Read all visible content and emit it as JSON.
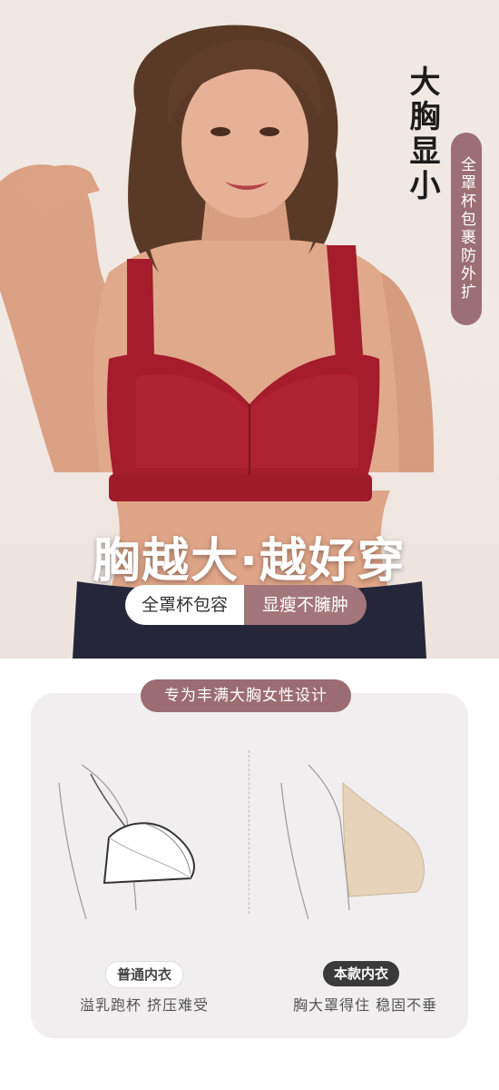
{
  "hero": {
    "headline": "大胸显小",
    "vertical_pill": "全罩杯包裹防外扩",
    "slogan": "胸越大·越好穿",
    "tag_left": "全罩杯包容",
    "tag_right": "显瘦不臃肿",
    "colors": {
      "bra": "#a51d2c",
      "pill": "#9b6f74",
      "background": "#efe7e2"
    }
  },
  "compare": {
    "title": "专为丰满大胸女性设计",
    "left": {
      "badge": "普通内衣",
      "caption": "溢乳跑杯 挤压难受"
    },
    "right": {
      "badge": "本款内衣",
      "caption": "胸大罩得住 稳固不垂"
    }
  }
}
